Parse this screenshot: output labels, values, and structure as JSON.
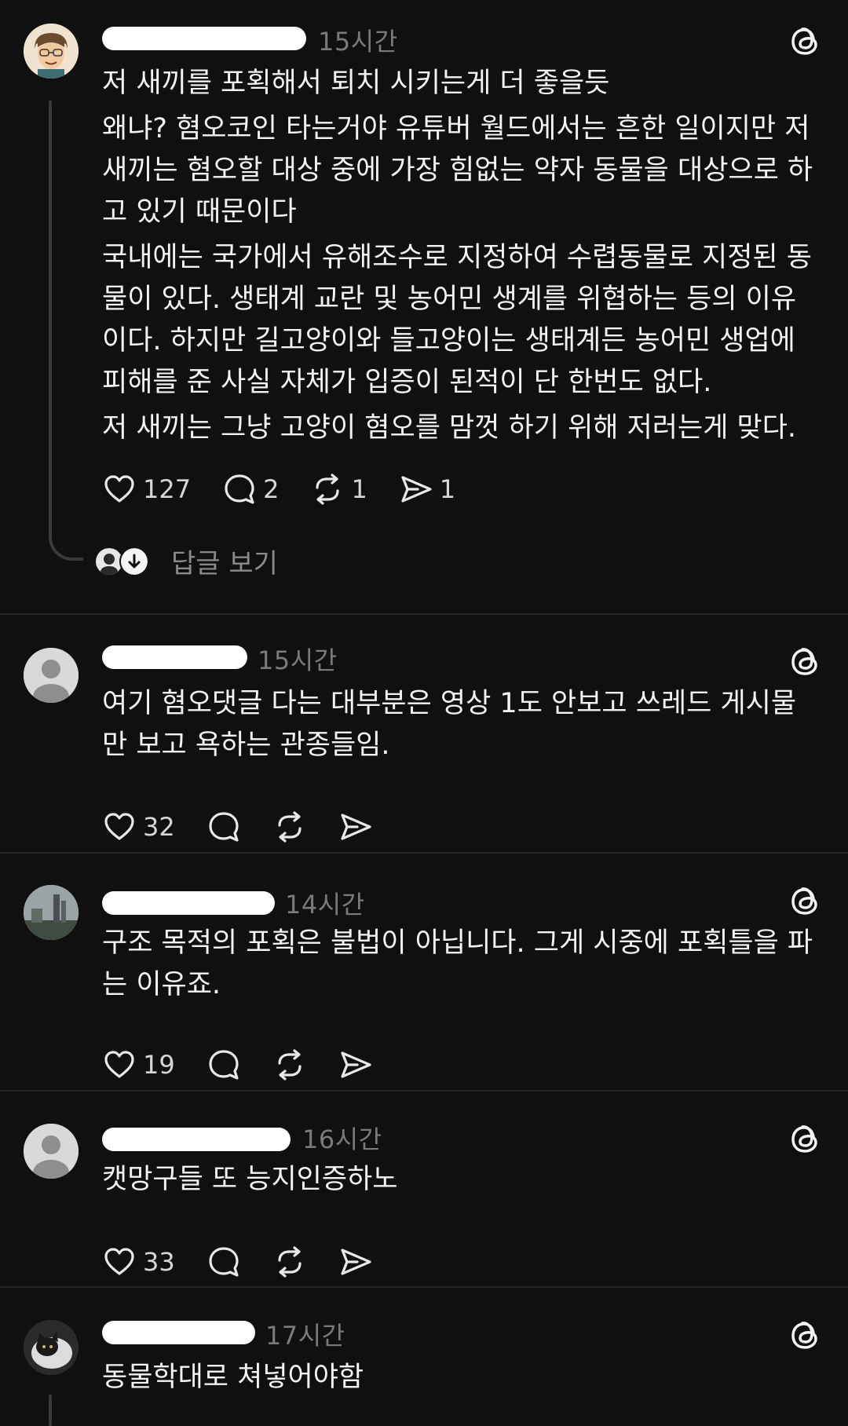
{
  "posts": [
    {
      "time": "15시간",
      "paragraphs": [
        "저 새끼를 포획해서 퇴치 시키는게 더 좋을듯",
        "왜냐? 혐오코인 타는거야 유튜버 월드에서는 흔한 일이지만 저 새끼는 혐오할 대상 중에 가장 힘없는 약자 동물을 대상으로 하고 있기 때문이다",
        "국내에는 국가에서 유해조수로 지정하여 수렵동물로 지정된 동물이 있다.  생태계 교란 및 농어민 생계를 위협하는 등의 이유이다.  하지만 길고양이와 들고양이는 생태계든 농어민 생업에 피해를 준 사실 자체가 입증이 된적이 단 한번도 없다.",
        "저 새끼는 그냥 고양이 혐오를 맘껏 하기 위해 저러는게 맞다."
      ],
      "likes": "127",
      "replies": "2",
      "reposts": "1",
      "shares": "1",
      "view_replies": "답글 보기"
    },
    {
      "time": "15시간",
      "paragraphs": [
        "여기 혐오댓글 다는 대부분은 영상 1도 안보고 쓰레드 게시물만 보고 욕하는 관종들임."
      ],
      "likes": "32"
    },
    {
      "time": "14시간",
      "paragraphs": [
        "구조 목적의 포획은 불법이 아닙니다. 그게 시중에 포획틀을 파는 이유죠."
      ],
      "likes": "19"
    },
    {
      "time": "16시간",
      "paragraphs": [
        "캣망구들 또 능지인증하노"
      ],
      "likes": "33"
    },
    {
      "time": "17시간",
      "paragraphs": [
        "동물학대로 쳐넣어야함"
      ]
    }
  ],
  "icons": {
    "like": "heart-icon",
    "reply": "comment-bubble-icon",
    "repost": "repost-icon",
    "share": "send-icon",
    "brand": "threads-logo-icon"
  },
  "colors": {
    "background": "#101010",
    "text": "#f3f3f3",
    "muted": "#7a7a7a",
    "divider": "#262626"
  }
}
